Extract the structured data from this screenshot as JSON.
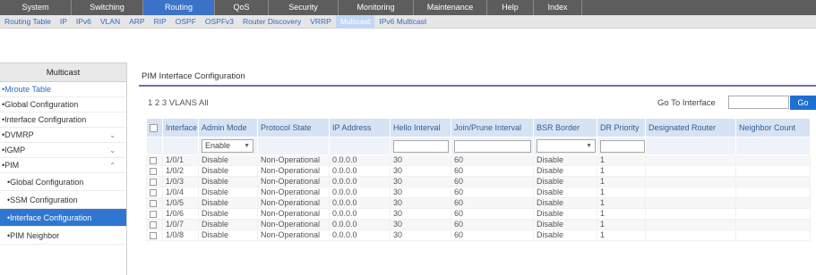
{
  "topnav": {
    "tabs": [
      {
        "label": "System"
      },
      {
        "label": "Switching"
      },
      {
        "label": "Routing"
      },
      {
        "label": "QoS"
      },
      {
        "label": "Security"
      },
      {
        "label": "Monitoring"
      },
      {
        "label": "Maintenance"
      },
      {
        "label": "Help"
      },
      {
        "label": "Index"
      }
    ],
    "active": "Routing"
  },
  "subnav": {
    "items": [
      {
        "label": "Routing Table"
      },
      {
        "label": "IP"
      },
      {
        "label": "IPv6"
      },
      {
        "label": "VLAN"
      },
      {
        "label": "ARP"
      },
      {
        "label": "RIP"
      },
      {
        "label": "OSPF"
      },
      {
        "label": "OSPFv3"
      },
      {
        "label": "Router Discovery"
      },
      {
        "label": "VRRP"
      },
      {
        "label": "Multicast"
      },
      {
        "label": "IPv6 Multicast"
      }
    ],
    "active": "Multicast"
  },
  "sidebar": {
    "title": "Multicast",
    "items": [
      {
        "label": "•Mroute Table"
      },
      {
        "label": "•Global Configuration"
      },
      {
        "label": "•Interface Configuration"
      },
      {
        "label": "•DVMRP"
      },
      {
        "label": "•IGMP"
      },
      {
        "label": "•PIM"
      },
      {
        "label": "•Global Configuration"
      },
      {
        "label": "•SSM Configuration"
      },
      {
        "label": "•Interface Configuration"
      },
      {
        "label": "•PIM Neighbor"
      }
    ]
  },
  "main": {
    "title": "PIM Interface Configuration",
    "vlans_link": "1 2 3 VLANS All",
    "goto_label": "Go To Interface",
    "goto_value": "",
    "go_button": "Go",
    "table": {
      "headers": [
        "Interface",
        "Admin Mode",
        "Protocol State",
        "IP Address",
        "Hello Interval",
        "Join/Prune Interval",
        "BSR Border",
        "DR Priority",
        "Designated Router",
        "Neighbor Count"
      ],
      "filter": {
        "admin_mode": "Enable",
        "bsr_border": ""
      },
      "rows": [
        {
          "interface": "1/0/1",
          "admin_mode": "Disable",
          "protocol_state": "Non-Operational",
          "ip": "0.0.0.0",
          "hello": "30",
          "join_prune": "60",
          "bsr_border": "Disable",
          "dr_priority": "1",
          "designated_router": "",
          "neighbor_count": ""
        },
        {
          "interface": "1/0/2",
          "admin_mode": "Disable",
          "protocol_state": "Non-Operational",
          "ip": "0.0.0.0",
          "hello": "30",
          "join_prune": "60",
          "bsr_border": "Disable",
          "dr_priority": "1",
          "designated_router": "",
          "neighbor_count": ""
        },
        {
          "interface": "1/0/3",
          "admin_mode": "Disable",
          "protocol_state": "Non-Operational",
          "ip": "0.0.0.0",
          "hello": "30",
          "join_prune": "60",
          "bsr_border": "Disable",
          "dr_priority": "1",
          "designated_router": "",
          "neighbor_count": ""
        },
        {
          "interface": "1/0/4",
          "admin_mode": "Disable",
          "protocol_state": "Non-Operational",
          "ip": "0.0.0.0",
          "hello": "30",
          "join_prune": "60",
          "bsr_border": "Disable",
          "dr_priority": "1",
          "designated_router": "",
          "neighbor_count": ""
        },
        {
          "interface": "1/0/5",
          "admin_mode": "Disable",
          "protocol_state": "Non-Operational",
          "ip": "0.0.0.0",
          "hello": "30",
          "join_prune": "60",
          "bsr_border": "Disable",
          "dr_priority": "1",
          "designated_router": "",
          "neighbor_count": ""
        },
        {
          "interface": "1/0/6",
          "admin_mode": "Disable",
          "protocol_state": "Non-Operational",
          "ip": "0.0.0.0",
          "hello": "30",
          "join_prune": "60",
          "bsr_border": "Disable",
          "dr_priority": "1",
          "designated_router": "",
          "neighbor_count": ""
        },
        {
          "interface": "1/0/7",
          "admin_mode": "Disable",
          "protocol_state": "Non-Operational",
          "ip": "0.0.0.0",
          "hello": "30",
          "join_prune": "60",
          "bsr_border": "Disable",
          "dr_priority": "1",
          "designated_router": "",
          "neighbor_count": ""
        },
        {
          "interface": "1/0/8",
          "admin_mode": "Disable",
          "protocol_state": "Non-Operational",
          "ip": "0.0.0.0",
          "hello": "30",
          "join_prune": "60",
          "bsr_border": "Disable",
          "dr_priority": "1",
          "designated_router": "",
          "neighbor_count": ""
        }
      ]
    }
  },
  "colors": {
    "topnav_bg": "#5d5d5d",
    "active_tab": "#3b73c8",
    "link": "#2d6bc2",
    "selected_sidebar": "#2f76d2",
    "header_row": "#d7e3f2",
    "title_rule": "#7e6aa9",
    "go_button": "#1f6fd1"
  }
}
